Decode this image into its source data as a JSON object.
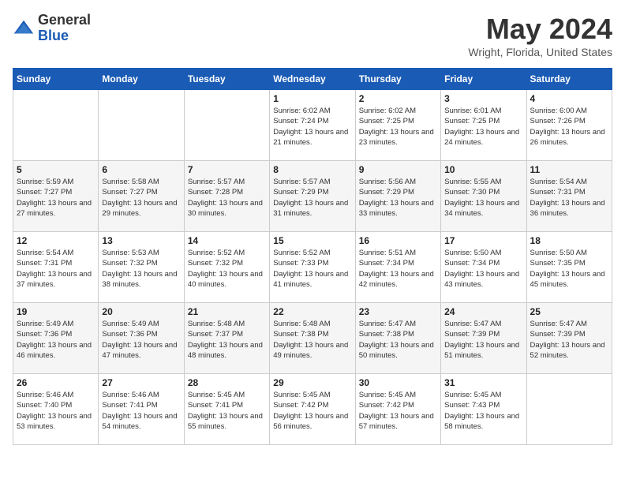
{
  "logo": {
    "general": "General",
    "blue": "Blue"
  },
  "title": "May 2024",
  "location": "Wright, Florida, United States",
  "weekdays": [
    "Sunday",
    "Monday",
    "Tuesday",
    "Wednesday",
    "Thursday",
    "Friday",
    "Saturday"
  ],
  "weeks": [
    [
      {
        "day": "",
        "sunrise": "",
        "sunset": "",
        "daylight": ""
      },
      {
        "day": "",
        "sunrise": "",
        "sunset": "",
        "daylight": ""
      },
      {
        "day": "",
        "sunrise": "",
        "sunset": "",
        "daylight": ""
      },
      {
        "day": "1",
        "sunrise": "Sunrise: 6:02 AM",
        "sunset": "Sunset: 7:24 PM",
        "daylight": "Daylight: 13 hours and 21 minutes."
      },
      {
        "day": "2",
        "sunrise": "Sunrise: 6:02 AM",
        "sunset": "Sunset: 7:25 PM",
        "daylight": "Daylight: 13 hours and 23 minutes."
      },
      {
        "day": "3",
        "sunrise": "Sunrise: 6:01 AM",
        "sunset": "Sunset: 7:25 PM",
        "daylight": "Daylight: 13 hours and 24 minutes."
      },
      {
        "day": "4",
        "sunrise": "Sunrise: 6:00 AM",
        "sunset": "Sunset: 7:26 PM",
        "daylight": "Daylight: 13 hours and 26 minutes."
      }
    ],
    [
      {
        "day": "5",
        "sunrise": "Sunrise: 5:59 AM",
        "sunset": "Sunset: 7:27 PM",
        "daylight": "Daylight: 13 hours and 27 minutes."
      },
      {
        "day": "6",
        "sunrise": "Sunrise: 5:58 AM",
        "sunset": "Sunset: 7:27 PM",
        "daylight": "Daylight: 13 hours and 29 minutes."
      },
      {
        "day": "7",
        "sunrise": "Sunrise: 5:57 AM",
        "sunset": "Sunset: 7:28 PM",
        "daylight": "Daylight: 13 hours and 30 minutes."
      },
      {
        "day": "8",
        "sunrise": "Sunrise: 5:57 AM",
        "sunset": "Sunset: 7:29 PM",
        "daylight": "Daylight: 13 hours and 31 minutes."
      },
      {
        "day": "9",
        "sunrise": "Sunrise: 5:56 AM",
        "sunset": "Sunset: 7:29 PM",
        "daylight": "Daylight: 13 hours and 33 minutes."
      },
      {
        "day": "10",
        "sunrise": "Sunrise: 5:55 AM",
        "sunset": "Sunset: 7:30 PM",
        "daylight": "Daylight: 13 hours and 34 minutes."
      },
      {
        "day": "11",
        "sunrise": "Sunrise: 5:54 AM",
        "sunset": "Sunset: 7:31 PM",
        "daylight": "Daylight: 13 hours and 36 minutes."
      }
    ],
    [
      {
        "day": "12",
        "sunrise": "Sunrise: 5:54 AM",
        "sunset": "Sunset: 7:31 PM",
        "daylight": "Daylight: 13 hours and 37 minutes."
      },
      {
        "day": "13",
        "sunrise": "Sunrise: 5:53 AM",
        "sunset": "Sunset: 7:32 PM",
        "daylight": "Daylight: 13 hours and 38 minutes."
      },
      {
        "day": "14",
        "sunrise": "Sunrise: 5:52 AM",
        "sunset": "Sunset: 7:32 PM",
        "daylight": "Daylight: 13 hours and 40 minutes."
      },
      {
        "day": "15",
        "sunrise": "Sunrise: 5:52 AM",
        "sunset": "Sunset: 7:33 PM",
        "daylight": "Daylight: 13 hours and 41 minutes."
      },
      {
        "day": "16",
        "sunrise": "Sunrise: 5:51 AM",
        "sunset": "Sunset: 7:34 PM",
        "daylight": "Daylight: 13 hours and 42 minutes."
      },
      {
        "day": "17",
        "sunrise": "Sunrise: 5:50 AM",
        "sunset": "Sunset: 7:34 PM",
        "daylight": "Daylight: 13 hours and 43 minutes."
      },
      {
        "day": "18",
        "sunrise": "Sunrise: 5:50 AM",
        "sunset": "Sunset: 7:35 PM",
        "daylight": "Daylight: 13 hours and 45 minutes."
      }
    ],
    [
      {
        "day": "19",
        "sunrise": "Sunrise: 5:49 AM",
        "sunset": "Sunset: 7:36 PM",
        "daylight": "Daylight: 13 hours and 46 minutes."
      },
      {
        "day": "20",
        "sunrise": "Sunrise: 5:49 AM",
        "sunset": "Sunset: 7:36 PM",
        "daylight": "Daylight: 13 hours and 47 minutes."
      },
      {
        "day": "21",
        "sunrise": "Sunrise: 5:48 AM",
        "sunset": "Sunset: 7:37 PM",
        "daylight": "Daylight: 13 hours and 48 minutes."
      },
      {
        "day": "22",
        "sunrise": "Sunrise: 5:48 AM",
        "sunset": "Sunset: 7:38 PM",
        "daylight": "Daylight: 13 hours and 49 minutes."
      },
      {
        "day": "23",
        "sunrise": "Sunrise: 5:47 AM",
        "sunset": "Sunset: 7:38 PM",
        "daylight": "Daylight: 13 hours and 50 minutes."
      },
      {
        "day": "24",
        "sunrise": "Sunrise: 5:47 AM",
        "sunset": "Sunset: 7:39 PM",
        "daylight": "Daylight: 13 hours and 51 minutes."
      },
      {
        "day": "25",
        "sunrise": "Sunrise: 5:47 AM",
        "sunset": "Sunset: 7:39 PM",
        "daylight": "Daylight: 13 hours and 52 minutes."
      }
    ],
    [
      {
        "day": "26",
        "sunrise": "Sunrise: 5:46 AM",
        "sunset": "Sunset: 7:40 PM",
        "daylight": "Daylight: 13 hours and 53 minutes."
      },
      {
        "day": "27",
        "sunrise": "Sunrise: 5:46 AM",
        "sunset": "Sunset: 7:41 PM",
        "daylight": "Daylight: 13 hours and 54 minutes."
      },
      {
        "day": "28",
        "sunrise": "Sunrise: 5:45 AM",
        "sunset": "Sunset: 7:41 PM",
        "daylight": "Daylight: 13 hours and 55 minutes."
      },
      {
        "day": "29",
        "sunrise": "Sunrise: 5:45 AM",
        "sunset": "Sunset: 7:42 PM",
        "daylight": "Daylight: 13 hours and 56 minutes."
      },
      {
        "day": "30",
        "sunrise": "Sunrise: 5:45 AM",
        "sunset": "Sunset: 7:42 PM",
        "daylight": "Daylight: 13 hours and 57 minutes."
      },
      {
        "day": "31",
        "sunrise": "Sunrise: 5:45 AM",
        "sunset": "Sunset: 7:43 PM",
        "daylight": "Daylight: 13 hours and 58 minutes."
      },
      {
        "day": "",
        "sunrise": "",
        "sunset": "",
        "daylight": ""
      }
    ]
  ]
}
